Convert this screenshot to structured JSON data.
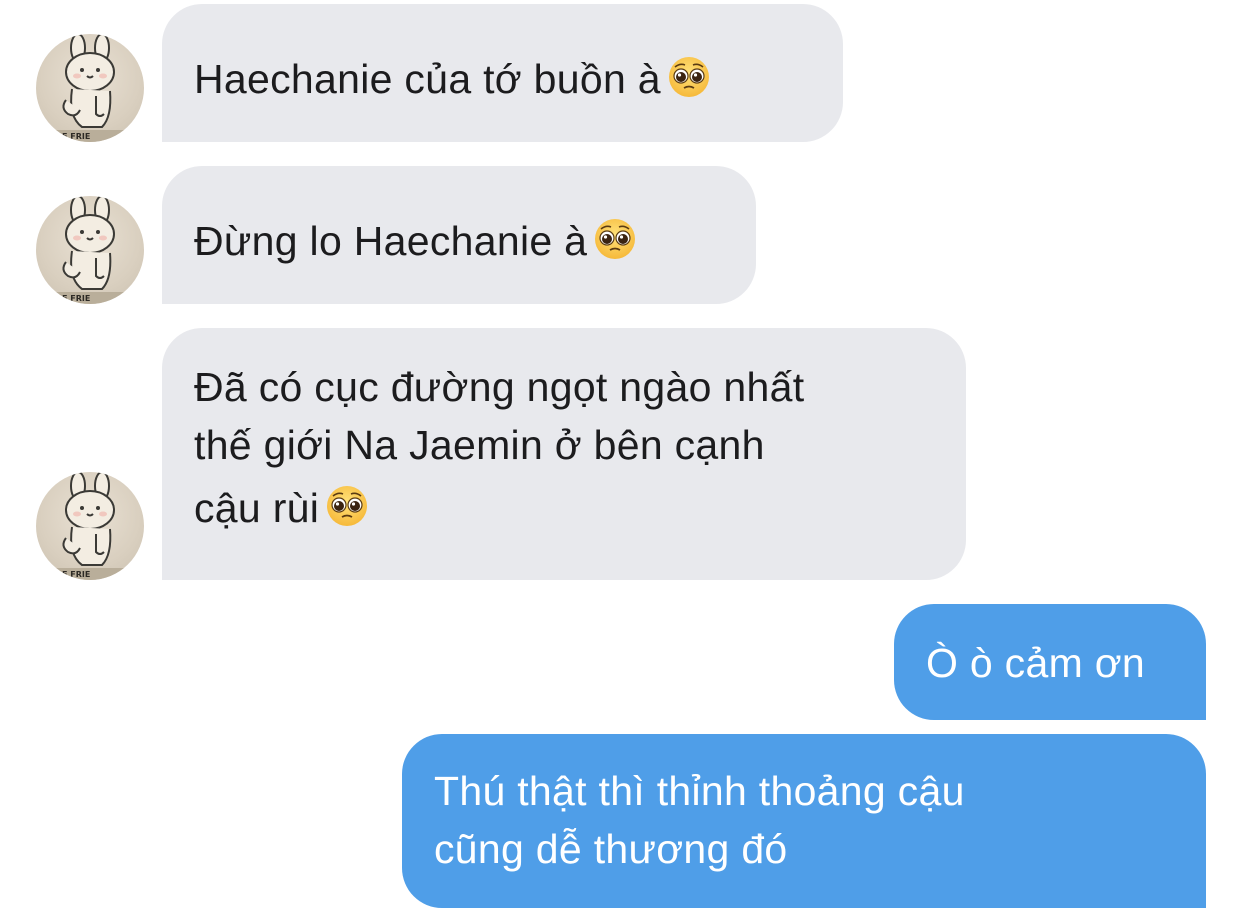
{
  "conversation": {
    "incoming": [
      {
        "text": "Haechanie của tớ buồn à",
        "emoji": "pleading-face-emoji"
      },
      {
        "text": "Đừng lo Haechanie à",
        "emoji": "pleading-face-emoji"
      },
      {
        "text_line1": "Đã có cục đường ngọt ngào nhất",
        "text_line2": "thế giới Na Jaemin ở bên cạnh",
        "text_line3": "cậu rùi",
        "emoji": "pleading-face-emoji"
      }
    ],
    "outgoing": [
      {
        "text": "Ò ò cảm ơn"
      },
      {
        "text_line1": "Thú thật thì thỉnh thoảng cậu",
        "text_line2": "cũng dễ thương đó"
      }
    ],
    "avatar_icon": "bunny-avatar-icon"
  },
  "colors": {
    "incoming_bubble": "#e8e9ed",
    "incoming_text": "#1c1c1e",
    "outgoing_bubble": "#4f9ee8",
    "outgoing_text": "#ffffff",
    "background": "#ffffff"
  }
}
